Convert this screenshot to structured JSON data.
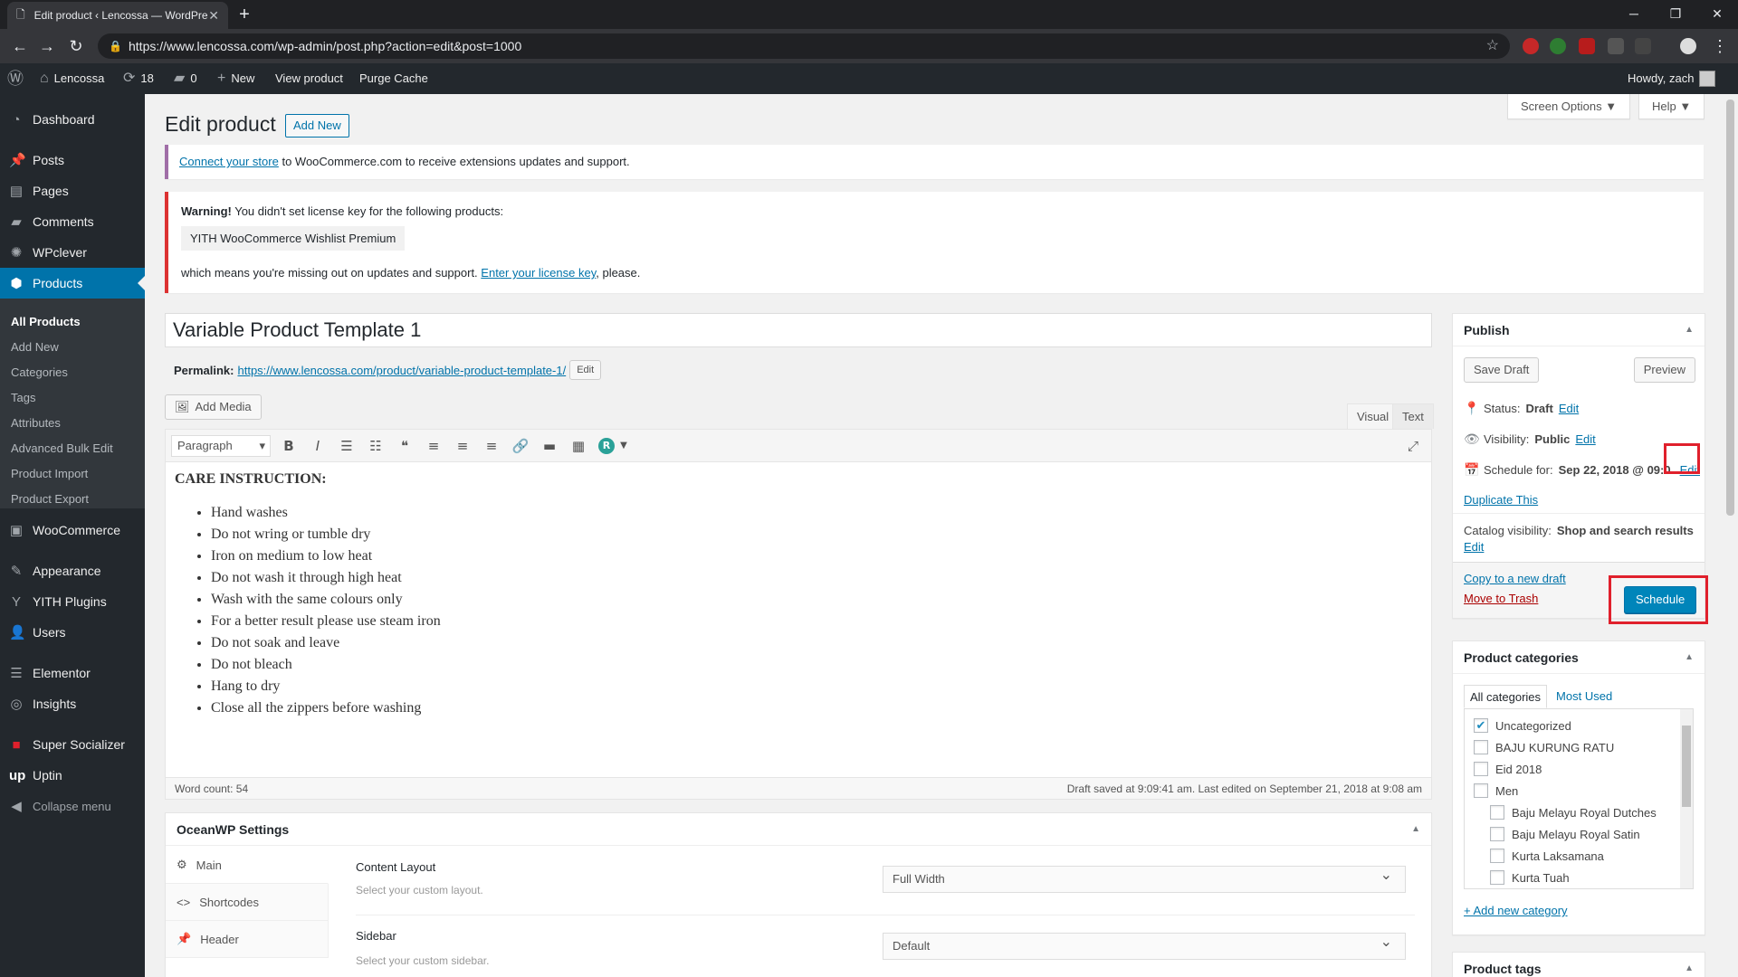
{
  "browser": {
    "tab_title": "Edit product ‹ Lencossa — WordPress",
    "url": "https://www.lencossa.com/wp-admin/post.php?action=edit&post=1000"
  },
  "adminbar": {
    "site_name": "Lencossa",
    "updates_count": "18",
    "comments_count": "0",
    "new_label": "New",
    "view_label": "View product",
    "purge_label": "Purge Cache",
    "howdy": "Howdy, zach"
  },
  "sidebar": {
    "items": [
      {
        "label": "Dashboard",
        "icon": "dashboard-icon"
      },
      {
        "label": "Posts",
        "icon": "pin-icon"
      },
      {
        "label": "Pages",
        "icon": "pages-icon"
      },
      {
        "label": "Comments",
        "icon": "comment-icon"
      },
      {
        "label": "WPclever",
        "icon": "gear-icon"
      },
      {
        "label": "Products",
        "icon": "cube-icon"
      },
      {
        "label": "WooCommerce",
        "icon": "woo-icon"
      },
      {
        "label": "Appearance",
        "icon": "brush-icon"
      },
      {
        "label": "YITH Plugins",
        "icon": "yith-icon"
      },
      {
        "label": "Users",
        "icon": "user-icon"
      },
      {
        "label": "Elementor",
        "icon": "elementor-icon"
      },
      {
        "label": "Insights",
        "icon": "insights-icon"
      },
      {
        "label": "Super Socializer",
        "icon": "socializer-icon"
      },
      {
        "label": "Uptin",
        "icon": "uptin-icon"
      }
    ],
    "submenu": [
      "All Products",
      "Add New",
      "Categories",
      "Tags",
      "Attributes",
      "Advanced Bulk Edit",
      "Product Import",
      "Product Export"
    ],
    "collapse": "Collapse menu"
  },
  "header": {
    "title": "Edit product",
    "add_new": "Add New",
    "screen_options": "Screen Options ▼",
    "help": "Help ▼"
  },
  "notices": {
    "connect_link": "Connect your store",
    "connect_rest": " to WooCommerce.com to receive extensions updates and support.",
    "warning_bold": "Warning!",
    "warning_rest": " You didn't set license key for the following products:",
    "product_chip": "YITH WooCommerce Wishlist Premium",
    "missing_text": "which means you're missing out on updates and support. ",
    "license_link": "Enter your license key",
    "please": ", please."
  },
  "post": {
    "title": "Variable Product Template 1",
    "permalink_label": "Permalink:",
    "permalink_url": "https://www.lencossa.com/product/variable-product-template-1/",
    "edit_btn": "Edit",
    "add_media": "Add Media",
    "tab_visual": "Visual",
    "tab_text": "Text",
    "format": "Paragraph",
    "heading": "CARE INSTRUCTION:",
    "list": [
      "Hand washes",
      "Do not wring or tumble dry",
      "Iron on medium to low heat",
      "Do not wash it through high heat",
      "Wash with the same colours only",
      "For a better result please use steam iron",
      "Do not soak and leave",
      "Do not bleach",
      "Hang to dry",
      "Close all the zippers before washing"
    ],
    "word_count": "Word count: 54",
    "draft_saved": "Draft saved at 9:09:41 am. Last edited on September 21, 2018 at 9:08 am"
  },
  "oceanwp": {
    "title": "OceanWP Settings",
    "tabs": [
      "Main",
      "Shortcodes",
      "Header"
    ],
    "content_layout_label": "Content Layout",
    "content_layout_desc": "Select your custom layout.",
    "content_layout_value": "Full Width",
    "sidebar_label": "Sidebar",
    "sidebar_desc": "Select your custom sidebar.",
    "sidebar_value": "Default"
  },
  "publish": {
    "title": "Publish",
    "save_draft": "Save Draft",
    "preview": "Preview",
    "status_label": "Status: ",
    "status_value": "Draft",
    "visibility_label": "Visibility: ",
    "visibility_value": "Public",
    "schedule_label": "Schedule for: ",
    "schedule_value": "Sep 22, 2018 @ 09:0",
    "edit": "Edit",
    "duplicate": "Duplicate This",
    "catalog_label": "Catalog visibility: ",
    "catalog_value": "Shop and search results",
    "copy_draft": "Copy to a new draft",
    "trash": "Move to Trash",
    "schedule_btn": "Schedule"
  },
  "categories": {
    "title": "Product categories",
    "tab_all": "All categories",
    "tab_used": "Most Used",
    "items": [
      {
        "label": "Uncategorized",
        "checked": true,
        "indent": 0
      },
      {
        "label": "BAJU KURUNG RATU",
        "checked": false,
        "indent": 0
      },
      {
        "label": "Eid 2018",
        "checked": false,
        "indent": 0
      },
      {
        "label": "Men",
        "checked": false,
        "indent": 0
      },
      {
        "label": "Baju Melayu Royal Dutches",
        "checked": false,
        "indent": 1
      },
      {
        "label": "Baju Melayu Royal Satin",
        "checked": false,
        "indent": 1
      },
      {
        "label": "Kurta Laksamana",
        "checked": false,
        "indent": 1
      },
      {
        "label": "Kurta Tuah",
        "checked": false,
        "indent": 1
      }
    ],
    "add_new": "+ Add new category"
  },
  "tags": {
    "title": "Product tags"
  }
}
